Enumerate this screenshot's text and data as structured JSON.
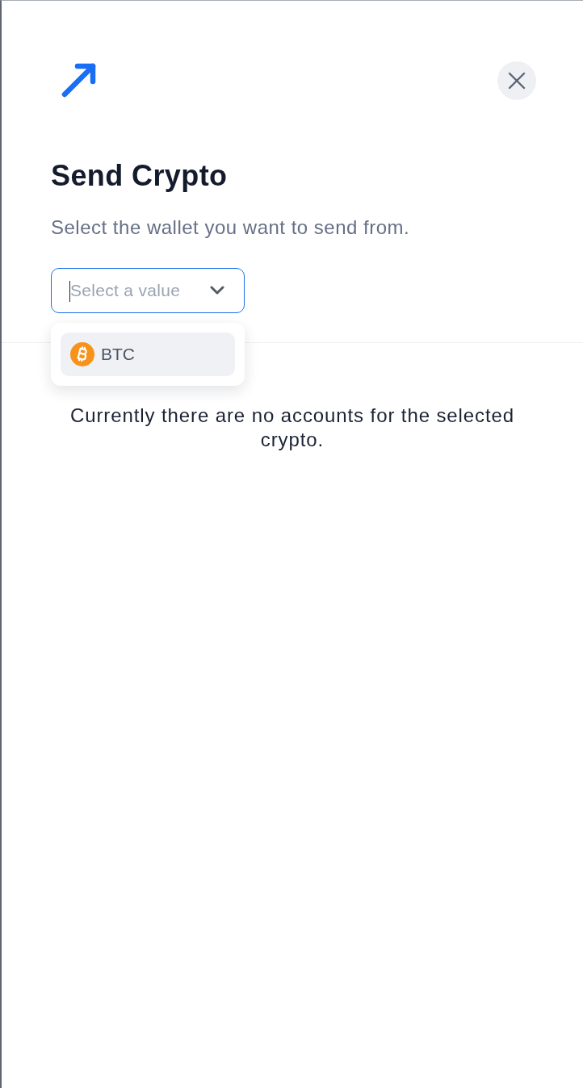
{
  "title": "Send Crypto",
  "subtitle": "Select the wallet you want to send from.",
  "wallet_select": {
    "placeholder": "Select a value",
    "expanded": true,
    "options": [
      {
        "label": "BTC",
        "highlighted": true
      }
    ]
  },
  "empty_message": "Currently there are no accounts for the selected crypto."
}
